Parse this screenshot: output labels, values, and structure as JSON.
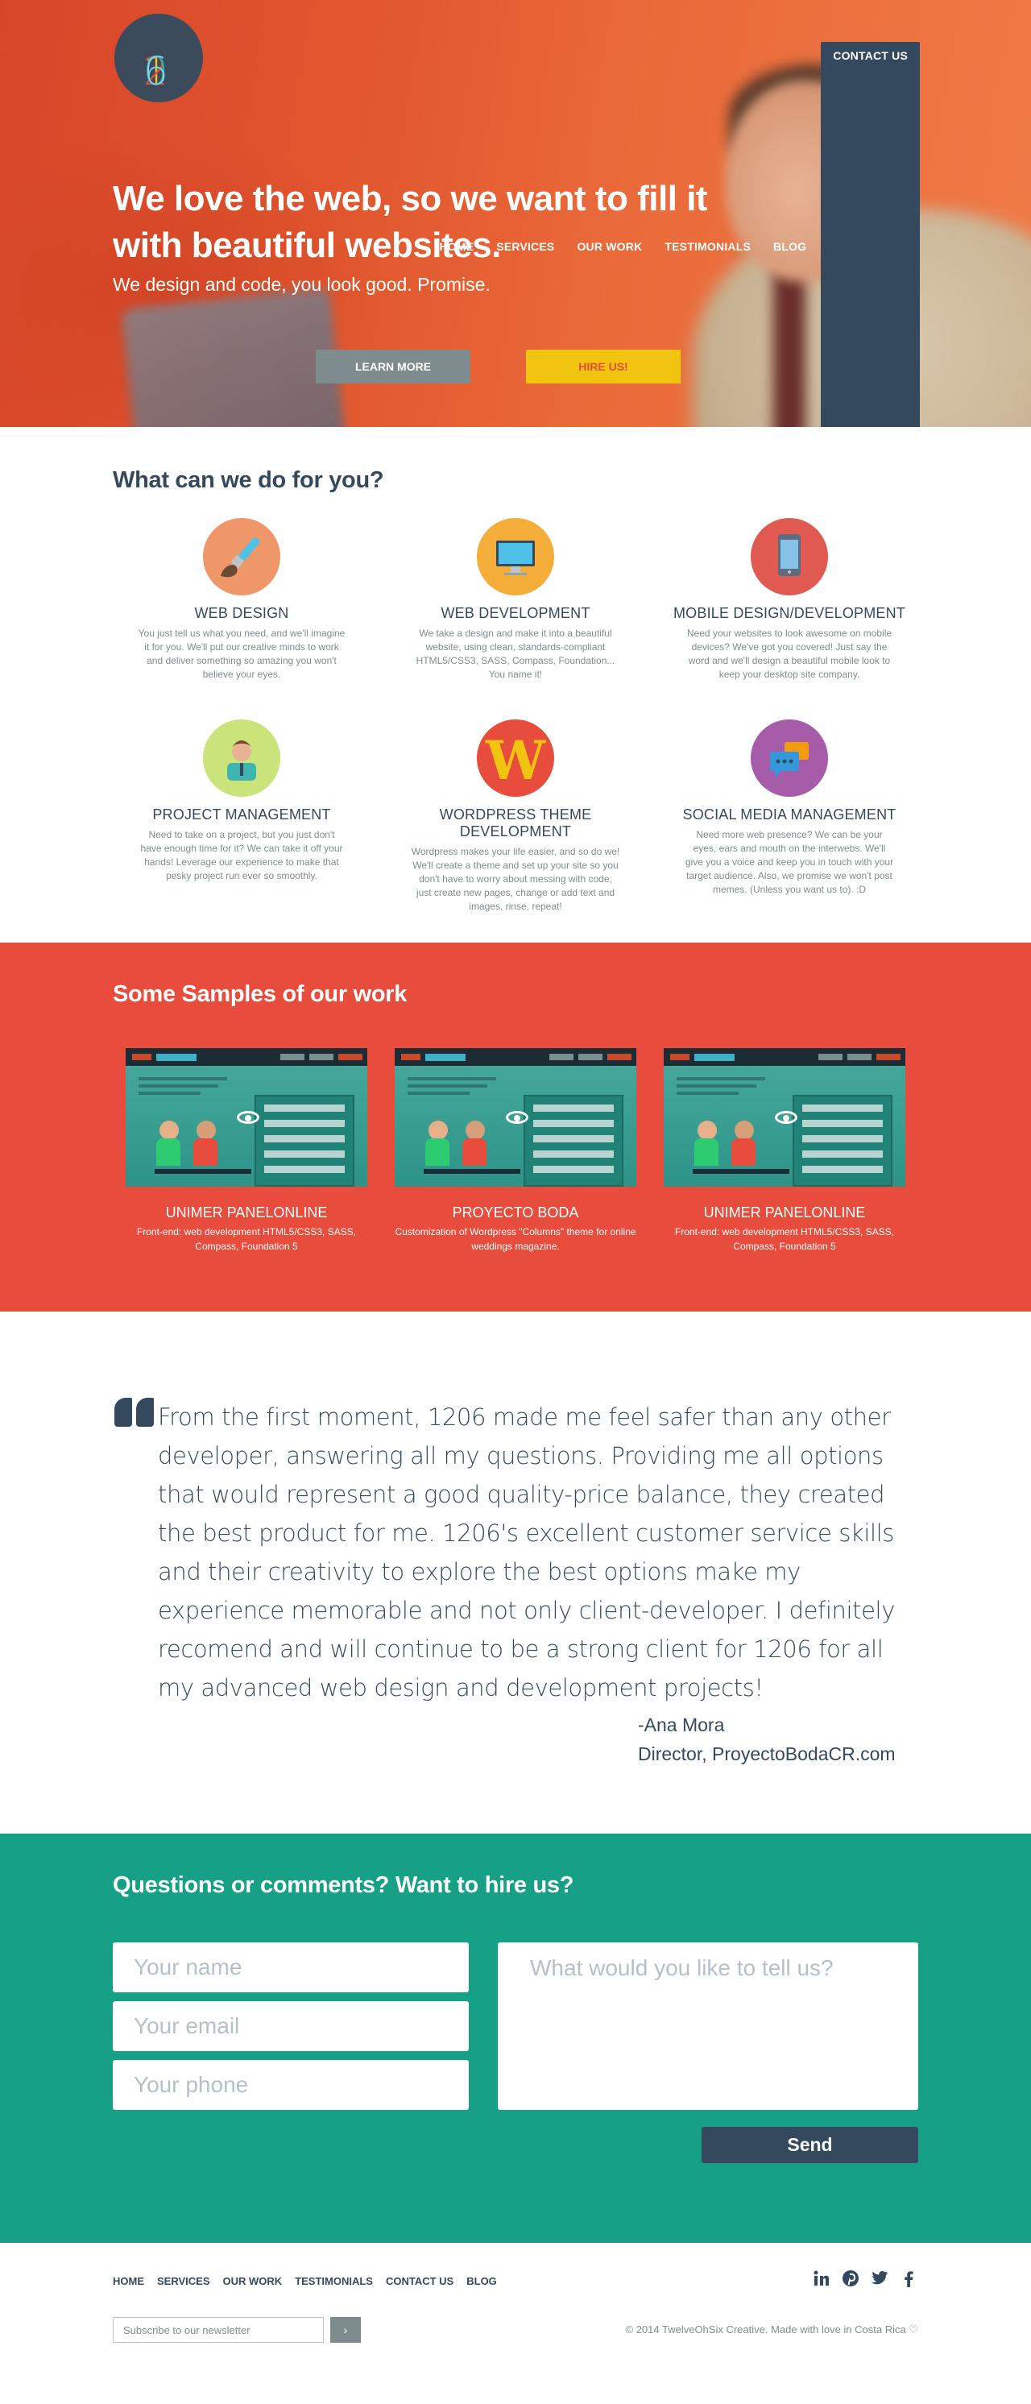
{
  "logo": {
    "digits": [
      "1",
      "2",
      "0",
      "6"
    ]
  },
  "nav": {
    "items": [
      "HOME",
      "SERVICES",
      "OUR WORK",
      "TESTIMONIALS",
      "BLOG"
    ],
    "contact": "CONTACT US"
  },
  "hero": {
    "headline": "We love the web, so we want to fill it with beautiful websites.",
    "tagline": "We design and code, you look good. Promise.",
    "learn_more": "LEARN MORE",
    "hire_us": "HIRE US!"
  },
  "services": {
    "title": "What can we do for you?",
    "items": [
      {
        "title": "WEB DESIGN",
        "text": "You just tell us what you need, and we'll imagine it for you. We'll put our creative minds to work and deliver something so amazing you won't believe your eyes.",
        "icon": "paintbrush-icon",
        "color": "#f0976a"
      },
      {
        "title": "WEB DEVELOPMENT",
        "text": "We take a design and make it into a beautiful website, using clean, standards-compliant HTML5/CSS3, SASS, Compass, Foundation... You name it!",
        "icon": "monitor-icon",
        "color": "#f5ad3a"
      },
      {
        "title": "MOBILE DESIGN/DEVELOPMENT",
        "text": "Need your websites to look awesome on mobile devices? We've got you covered! Just say the word and we'll design a beautiful mobile look to keep your desktop site company.",
        "icon": "smartphone-icon",
        "color": "#e05a51"
      },
      {
        "title": "PROJECT MANAGEMENT",
        "text": "Need to take on a project, but you just don't have enough time for it? We can take it off your hands! Leverage our experience to make that pesky project run ever so smoothly.",
        "icon": "manager-icon",
        "color": "#cbe37b"
      },
      {
        "title": "WORDPRESS THEME DEVELOPMENT",
        "text": "Wordpress makes your life easier, and so do we! We'll create a theme and set up your site so you don't have to worry about messing with code, just create new pages, change or add text and images, rinse, repeat!",
        "icon": "wordpress-icon",
        "color": "#e74c3c"
      },
      {
        "title": "SOCIAL MEDIA MANAGEMENT",
        "text": "Need more web presence? We can be your eyes, ears and mouth on the interwebs. We'll give you a voice and keep you in touch with your target audience. Also, we promise we won't post memes. (Unless you want us to). :D",
        "icon": "chat-bubbles-icon",
        "color": "#a65ca8"
      }
    ]
  },
  "work": {
    "title": "Some Samples of our work",
    "items": [
      {
        "title": "UNIMER PANELONLINE",
        "text": "Front-end: web development HTML5/CSS3, SASS, Compass, Foundation 5"
      },
      {
        "title": "PROYECTO BODA",
        "text": "Customization of Wordpress \"Columns\" theme for online weddings magazine."
      },
      {
        "title": "UNIMER PANELONLINE",
        "text": "Front-end: web development HTML5/CSS3, SASS, Compass, Foundation 5"
      }
    ]
  },
  "testimonial": {
    "quote": "From the first moment, 1206 made me feel safer than any other developer, answering all my questions. Providing me all options that would represent a good quality-price balance, they created the best product for me. 1206's excellent customer service skills and their creativity to explore the best options make my experience memorable and not only client-developer. I definitely recomend and will continue to be a strong client for 1206 for all my advanced web design and development projects!",
    "author": "-Ana Mora",
    "role": "Director, ProyectoBodaCR.com"
  },
  "contact": {
    "title": "Questions or comments? Want to hire us?",
    "name_placeholder": "Your name",
    "email_placeholder": "Your email",
    "phone_placeholder": "Your phone",
    "message_placeholder": "What would you like to tell us?",
    "send": "Send"
  },
  "footer": {
    "links": [
      "HOME",
      "SERVICES",
      "OUR WORK",
      "TESTIMONIALS",
      "CONTACT US",
      "BLOG"
    ],
    "newsletter_placeholder": "Subscribe to our newsletter",
    "newsletter_button": "›",
    "copyright": "© 2014 TwelveOhSix Creative. Made with love in Costa Rica ♡",
    "social": [
      "linkedin-icon",
      "pinterest-icon",
      "twitter-icon",
      "facebook-icon"
    ]
  },
  "colors": {
    "hero": "#e2582f",
    "dark": "#34495e",
    "red": "#e74c3c",
    "green": "#16a085",
    "yellow": "#f1c40f",
    "gray": "#7f8c8d"
  }
}
